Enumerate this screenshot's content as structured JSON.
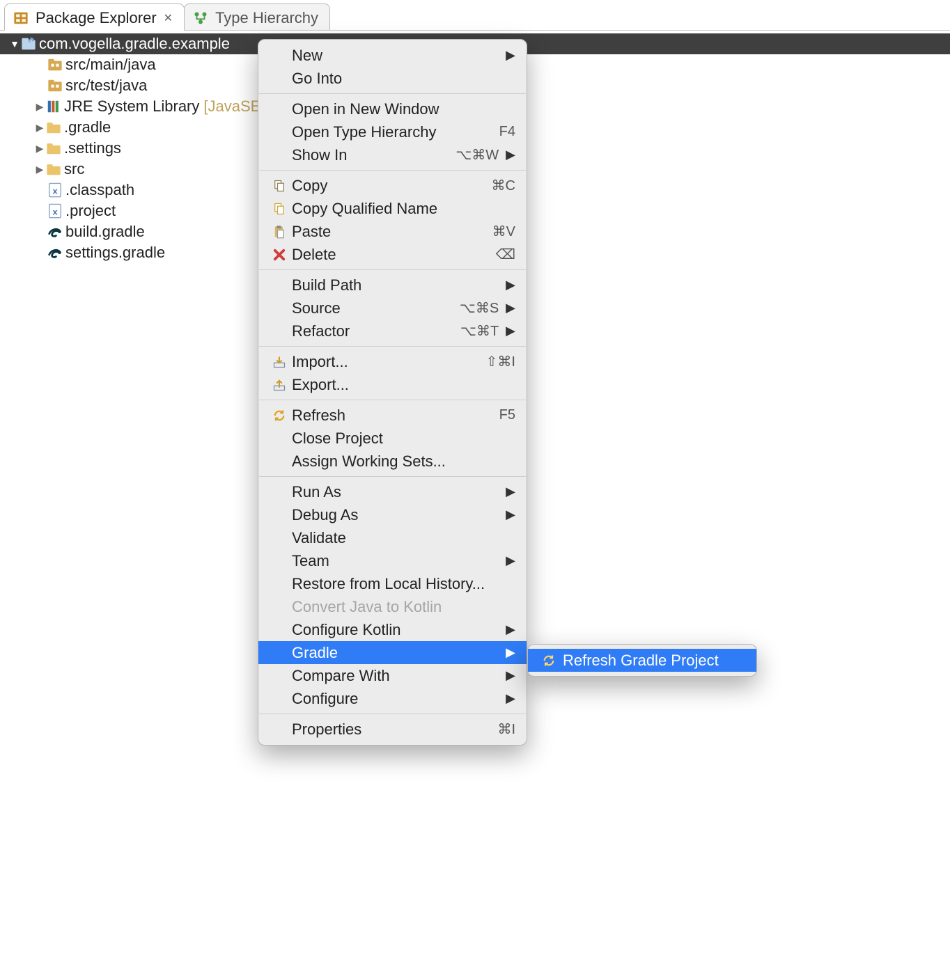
{
  "tabs": {
    "package_explorer": "Package Explorer",
    "type_hierarchy": "Type Hierarchy"
  },
  "tree": {
    "project": "com.vogella.gradle.example",
    "src_main_java": "src/main/java",
    "src_test_java": "src/test/java",
    "jre": "JRE System Library",
    "jre_suffix": "[JavaSE-",
    "gradle_dir": ".gradle",
    "settings_dir": ".settings",
    "src_dir": "src",
    "classpath": ".classpath",
    "project_file": ".project",
    "build_gradle": "build.gradle",
    "settings_gradle": "settings.gradle"
  },
  "menu": {
    "new": "New",
    "go_into": "Go Into",
    "open_new_window": "Open in New Window",
    "open_type_hierarchy": "Open Type Hierarchy",
    "open_type_hierarchy_sc": "F4",
    "show_in": "Show In",
    "show_in_sc": "⌥⌘W",
    "copy": "Copy",
    "copy_sc": "⌘C",
    "copy_qualified": "Copy Qualified Name",
    "paste": "Paste",
    "paste_sc": "⌘V",
    "delete": "Delete",
    "delete_sc": "⌫",
    "build_path": "Build Path",
    "source": "Source",
    "source_sc": "⌥⌘S",
    "refactor": "Refactor",
    "refactor_sc": "⌥⌘T",
    "import": "Import...",
    "import_sc": "⇧⌘I",
    "export": "Export...",
    "refresh": "Refresh",
    "refresh_sc": "F5",
    "close_project": "Close Project",
    "assign_ws": "Assign Working Sets...",
    "run_as": "Run As",
    "debug_as": "Debug As",
    "validate": "Validate",
    "team": "Team",
    "restore_history": "Restore from Local History...",
    "convert_kotlin": "Convert Java to Kotlin",
    "configure_kotlin": "Configure Kotlin",
    "gradle": "Gradle",
    "compare_with": "Compare With",
    "configure": "Configure",
    "properties": "Properties",
    "properties_sc": "⌘I"
  },
  "submenu": {
    "refresh_gradle": "Refresh Gradle Project"
  }
}
